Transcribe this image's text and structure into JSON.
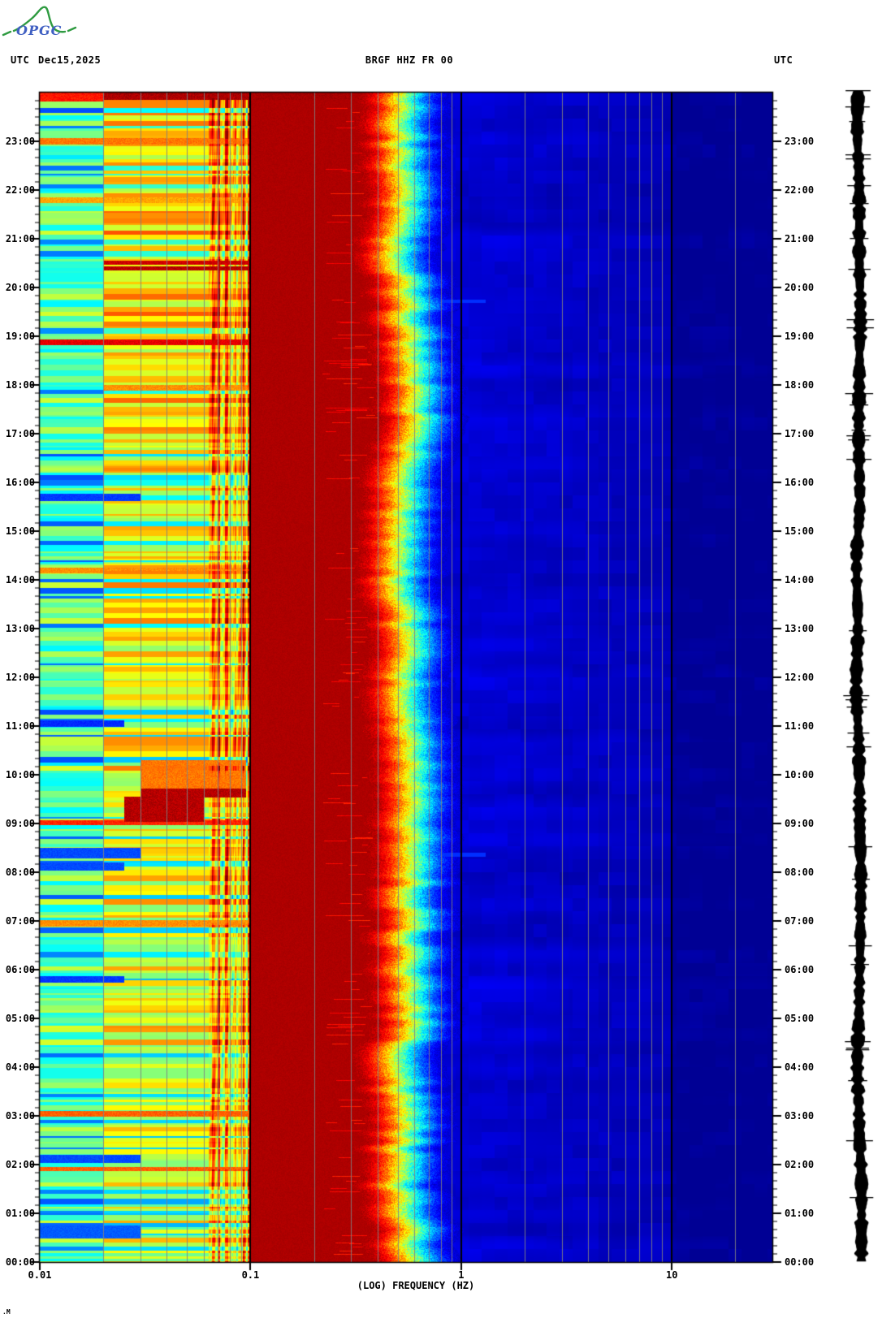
{
  "page": {
    "background": "#ffffff",
    "corner_mark": ".M"
  },
  "logo": {
    "text": "OPGC",
    "text_color": "#3f5fc2",
    "curve_color": "#2f9b41"
  },
  "header": {
    "utc_label_left": "UTC",
    "date": "Dec15,2025",
    "title": "BRGF HHZ FR 00",
    "utc_label_right": "UTC"
  },
  "chart_data": {
    "type": "heatmap",
    "title": "BRGF HHZ FR 00",
    "subtitle": "24-hour spectrogram (log frequency vs UTC time) with helicorder amplitude trace at right",
    "colormap": "jet",
    "x_axis": {
      "label": "(LOG) FREQUENCY (HZ)",
      "scale": "log",
      "min_hz": 0.01,
      "max_hz": 30,
      "tick_values": [
        0.01,
        0.1,
        1,
        10
      ],
      "tick_labels": [
        "0.01",
        "0.1",
        "1",
        "10"
      ],
      "decade_line_color": "#000000",
      "minor_gridline_color": "#828282"
    },
    "y_axis": {
      "unit": "UTC",
      "direction": "00:00 at bottom, 24:00 at top",
      "minor_tick_minutes": 10,
      "hour_labels_top_to_bottom": [
        "23:00",
        "22:00",
        "21:00",
        "20:00",
        "19:00",
        "18:00",
        "17:00",
        "16:00",
        "15:00",
        "14:00",
        "13:00",
        "12:00",
        "11:00",
        "10:00",
        "09:00",
        "08:00",
        "07:00",
        "06:00",
        "05:00",
        "04:00",
        "03:00",
        "02:00",
        "01:00",
        "00:00"
      ]
    },
    "bands": [
      {
        "f_lo": 0.01,
        "f_hi": 0.02,
        "base_v": 0.3,
        "band_gain": 0.3,
        "desc": "cyan background with horizontal green/yellow banding"
      },
      {
        "f_lo": 0.02,
        "f_hi": 0.063,
        "base_v": 0.42,
        "band_gain": 0.34,
        "desc": "green-yellow banded zone"
      },
      {
        "f_lo": 0.063,
        "f_hi": 0.1,
        "base_v": 0.55,
        "band_gain": 0.27,
        "stripe_gain": 0.3,
        "desc": "dense yellow/orange/dark-red vertical striping"
      },
      {
        "f_lo": 0.1,
        "f_hi": 0.28,
        "v": 0.955,
        "desc": "solid dark-red secondary microseism band"
      },
      {
        "f_lo": 0.28,
        "f_hi": 0.45,
        "v": 0.95,
        "streaks": true,
        "desc": "dark red with bright red horizontal streaks"
      },
      {
        "f_lo": 0.45,
        "f_hi": 0.62,
        "edge_center_hz": 0.57,
        "desc": "noisy flame edge: red-orange-yellow-cyan transition"
      },
      {
        "f_lo": 0.62,
        "f_hi": 10.0,
        "base_v": 0.085,
        "desc": "deep blue quiet band with faint horizontal texture"
      },
      {
        "f_lo": 10.0,
        "f_hi": 30.0,
        "base_v": 0.045,
        "desc": "navy, slightly darker above 10 Hz"
      }
    ],
    "features": [
      {
        "type": "hot",
        "t": [
          23.83,
          24.0
        ],
        "f": [
          0.01,
          0.02
        ],
        "s": 0.75
      },
      {
        "type": "hot",
        "t": [
          23.86,
          24.0
        ],
        "f": [
          0.02,
          0.3
        ],
        "s": 0.97
      },
      {
        "type": "hot",
        "t": [
          22.95,
          23.08
        ],
        "f": [
          0.01,
          0.1
        ],
        "s": 0.55
      },
      {
        "type": "hot",
        "t": [
          21.75,
          21.85
        ],
        "f": [
          0.01,
          0.1
        ],
        "s": 0.45
      },
      {
        "type": "hot",
        "t": [
          20.35,
          20.44
        ],
        "f": [
          0.02,
          0.1
        ],
        "s": 0.95
      },
      {
        "type": "hot",
        "t": [
          20.48,
          20.56
        ],
        "f": [
          0.02,
          0.1
        ],
        "s": 0.9
      },
      {
        "type": "hot",
        "t": [
          18.82,
          18.95
        ],
        "f": [
          0.01,
          0.1
        ],
        "s": 0.85
      },
      {
        "type": "hot",
        "t": [
          17.9,
          18.0
        ],
        "f": [
          0.02,
          0.1
        ],
        "s": 0.5
      },
      {
        "type": "hot",
        "t": [
          14.15,
          14.25
        ],
        "f": [
          0.01,
          0.1
        ],
        "s": 0.5
      },
      {
        "type": "hot",
        "t": [
          9.7,
          10.3
        ],
        "f": [
          0.03,
          0.095
        ],
        "s": 0.55
      },
      {
        "type": "hot",
        "t": [
          9.55,
          9.72
        ],
        "f": [
          0.03,
          0.095
        ],
        "s": 0.95
      },
      {
        "type": "hot",
        "t": [
          9.05,
          9.55
        ],
        "f": [
          0.025,
          0.06
        ],
        "s": 0.95
      },
      {
        "type": "hot",
        "t": [
          8.97,
          9.07
        ],
        "f": [
          0.01,
          0.1
        ],
        "s": 0.72
      },
      {
        "type": "hot",
        "t": [
          6.9,
          7.02
        ],
        "f": [
          0.01,
          0.1
        ],
        "s": 0.5
      },
      {
        "type": "hot",
        "t": [
          3.0,
          3.1
        ],
        "f": [
          0.01,
          0.1
        ],
        "s": 0.6
      },
      {
        "type": "hot",
        "t": [
          1.88,
          1.96
        ],
        "f": [
          0.01,
          0.1
        ],
        "s": 0.6
      },
      {
        "type": "dip",
        "t": [
          15.63,
          15.78
        ],
        "f": [
          0.01,
          0.03
        ],
        "s": 0.7
      },
      {
        "type": "dip",
        "t": [
          11.0,
          11.12
        ],
        "f": [
          0.01,
          0.025
        ],
        "s": 0.8
      },
      {
        "type": "dip",
        "t": [
          8.05,
          8.2
        ],
        "f": [
          0.01,
          0.025
        ],
        "s": 0.6
      },
      {
        "type": "dip",
        "t": [
          8.3,
          8.5
        ],
        "f": [
          0.01,
          0.03
        ],
        "s": 0.6
      },
      {
        "type": "dip",
        "t": [
          5.75,
          5.88
        ],
        "f": [
          0.01,
          0.025
        ],
        "s": 0.7
      },
      {
        "type": "dip",
        "t": [
          2.05,
          2.2
        ],
        "f": [
          0.01,
          0.03
        ],
        "s": 0.6
      },
      {
        "type": "dip",
        "t": [
          0.5,
          0.75
        ],
        "f": [
          0.01,
          0.03
        ],
        "s": 0.5
      },
      {
        "type": "cyan",
        "t": [
          19.7,
          19.76
        ],
        "f": [
          0.6,
          1.3
        ],
        "s": 0.6
      },
      {
        "type": "cyan",
        "t": [
          8.32,
          8.4
        ],
        "f": [
          0.6,
          1.3
        ],
        "s": 0.6
      }
    ],
    "trace": {
      "name": "helicorder amplitude trace",
      "color": "#000000"
    }
  }
}
